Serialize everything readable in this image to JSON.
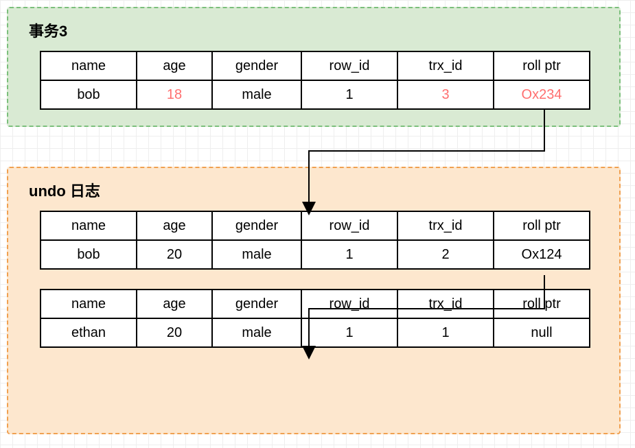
{
  "transaction": {
    "title": "事务3",
    "headers": {
      "name": "name",
      "age": "age",
      "gender": "gender",
      "row_id": "row_id",
      "trx_id": "trx_id",
      "roll_ptr": "roll ptr"
    },
    "row": {
      "name": "bob",
      "age": "18",
      "gender": "male",
      "row_id": "1",
      "trx_id": "3",
      "roll_ptr": "Ox234"
    }
  },
  "undo": {
    "title": "undo 日志",
    "headers": {
      "name": "name",
      "age": "age",
      "gender": "gender",
      "row_id": "row_id",
      "trx_id": "trx_id",
      "roll_ptr": "roll ptr"
    },
    "rows": [
      {
        "name": "bob",
        "age": "20",
        "gender": "male",
        "row_id": "1",
        "trx_id": "2",
        "roll_ptr": "Ox124"
      },
      {
        "name": "ethan",
        "age": "20",
        "gender": "male",
        "row_id": "1",
        "trx_id": "1",
        "roll_ptr": "null"
      }
    ]
  }
}
